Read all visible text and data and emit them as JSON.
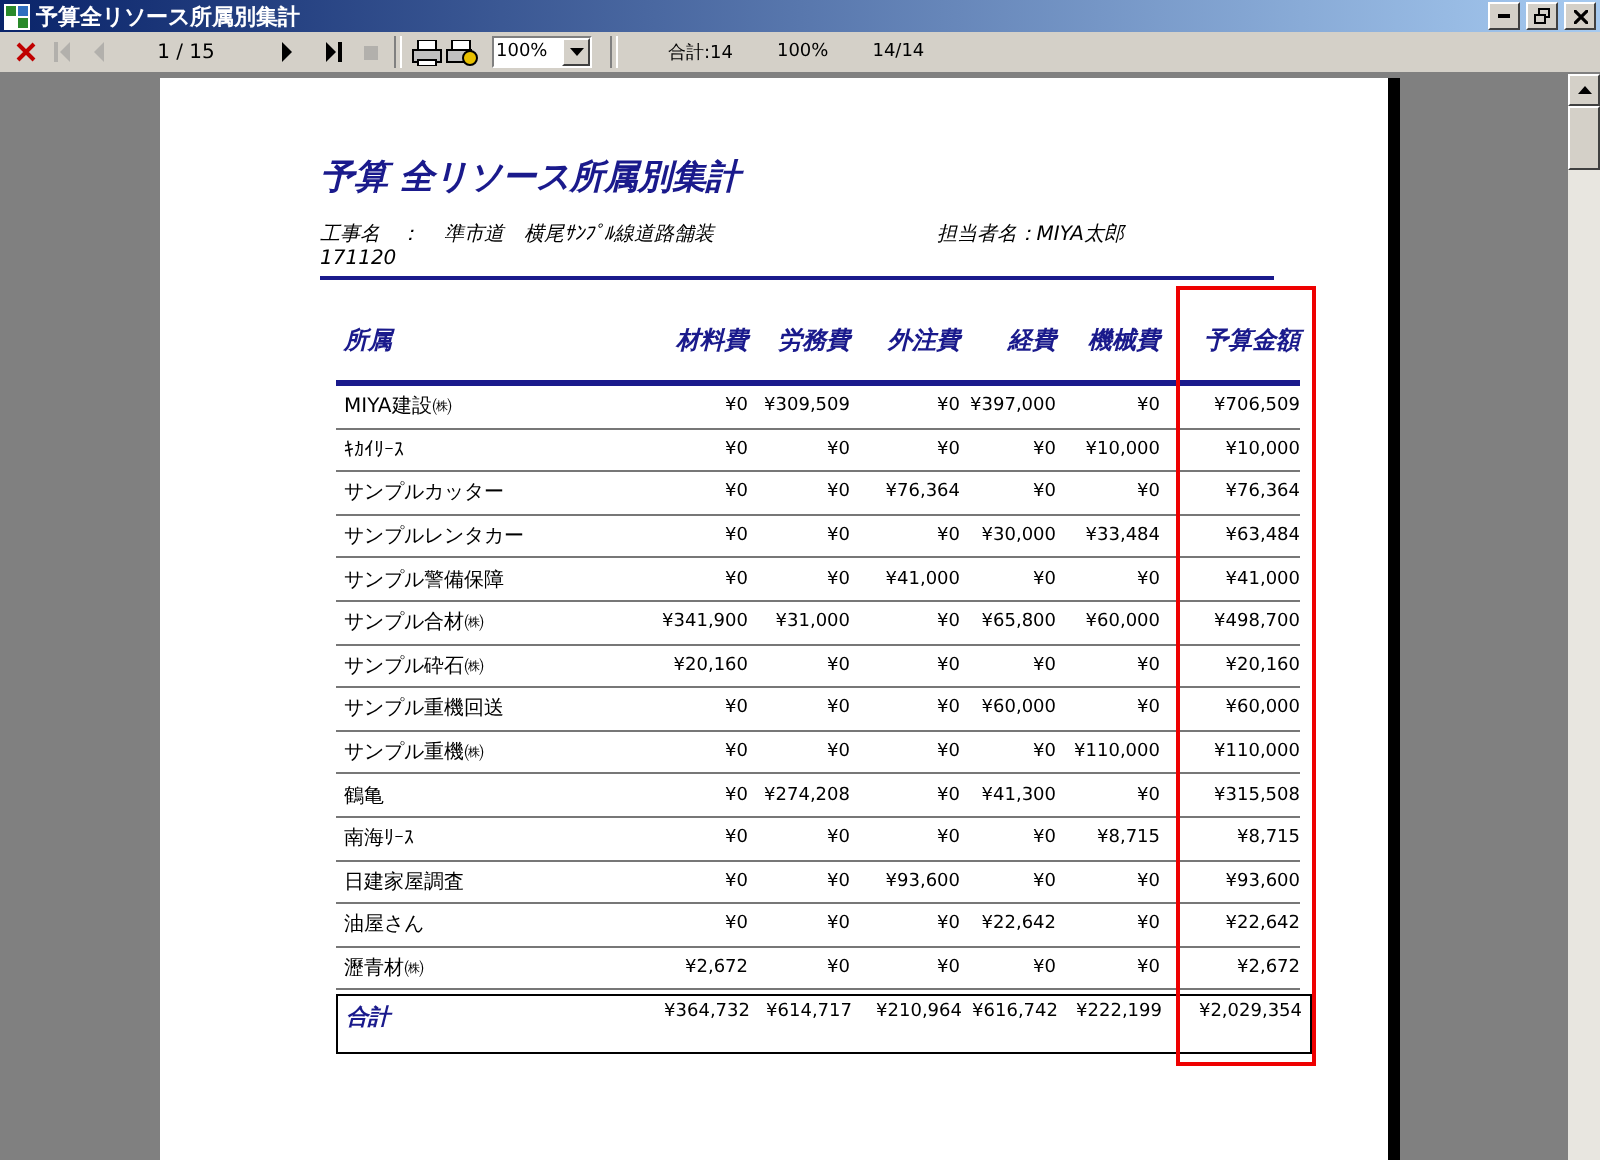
{
  "window": {
    "title": "予算全リソース所属別集計"
  },
  "toolbar": {
    "page_indicator": "1 / 15",
    "zoom": "100%",
    "status": [
      {
        "text": "合計:14"
      },
      {
        "text": "100%"
      },
      {
        "text": "14/14"
      }
    ],
    "buttons": [
      {
        "kind": "close",
        "disabled": false
      },
      {
        "kind": "first",
        "disabled": true
      },
      {
        "kind": "prev",
        "disabled": true
      },
      {
        "kind": "page"
      },
      {
        "kind": "next",
        "disabled": false
      },
      {
        "kind": "last",
        "disabled": false
      },
      {
        "kind": "stop",
        "disabled": true
      },
      {
        "kind": "sep"
      },
      {
        "kind": "print",
        "disabled": false
      },
      {
        "kind": "setup",
        "disabled": false
      },
      {
        "kind": "zoom"
      }
    ]
  },
  "report": {
    "title": "予算 全リソース所属別集計",
    "project_label": "工事名　：",
    "project_name": "準市道　横尾ｻﾝﾌﾟﾙ線道路舗装",
    "project_code": "171120",
    "manager": "担当者名：MIYA太郎",
    "columns": [
      "所属",
      "材料費",
      "労務費",
      "外注費",
      "経費",
      "機械費",
      "予算金額"
    ],
    "rows": [
      [
        "MIYA建設㈱",
        "¥0",
        "¥309,509",
        "¥0",
        "¥397,000",
        "¥0",
        "¥706,509"
      ],
      [
        "ｷｶｲﾘｰｽ",
        "¥0",
        "¥0",
        "¥0",
        "¥0",
        "¥10,000",
        "¥10,000"
      ],
      [
        "サンプルカッター",
        "¥0",
        "¥0",
        "¥76,364",
        "¥0",
        "¥0",
        "¥76,364"
      ],
      [
        "サンプルレンタカー",
        "¥0",
        "¥0",
        "¥0",
        "¥30,000",
        "¥33,484",
        "¥63,484"
      ],
      [
        "サンプル警備保障",
        "¥0",
        "¥0",
        "¥41,000",
        "¥0",
        "¥0",
        "¥41,000"
      ],
      [
        "サンプル合材㈱",
        "¥341,900",
        "¥31,000",
        "¥0",
        "¥65,800",
        "¥60,000",
        "¥498,700"
      ],
      [
        "サンプル砕石㈱",
        "¥20,160",
        "¥0",
        "¥0",
        "¥0",
        "¥0",
        "¥20,160"
      ],
      [
        "サンプル重機回送",
        "¥0",
        "¥0",
        "¥0",
        "¥60,000",
        "¥0",
        "¥60,000"
      ],
      [
        "サンプル重機㈱",
        "¥0",
        "¥0",
        "¥0",
        "¥0",
        "¥110,000",
        "¥110,000"
      ],
      [
        "鶴亀",
        "¥0",
        "¥274,208",
        "¥0",
        "¥41,300",
        "¥0",
        "¥315,508"
      ],
      [
        "南海ﾘｰｽ",
        "¥0",
        "¥0",
        "¥0",
        "¥0",
        "¥8,715",
        "¥8,715"
      ],
      [
        "日建家屋調査",
        "¥0",
        "¥0",
        "¥93,600",
        "¥0",
        "¥0",
        "¥93,600"
      ],
      [
        "油屋さん",
        "¥0",
        "¥0",
        "¥0",
        "¥22,642",
        "¥0",
        "¥22,642"
      ],
      [
        "瀝青材㈱",
        "¥2,672",
        "¥0",
        "¥0",
        "¥0",
        "¥0",
        "¥2,672"
      ]
    ],
    "total": [
      "合計",
      "¥364,732",
      "¥614,717",
      "¥210,964",
      "¥616,742",
      "¥222,199",
      "¥2,029,354"
    ]
  }
}
